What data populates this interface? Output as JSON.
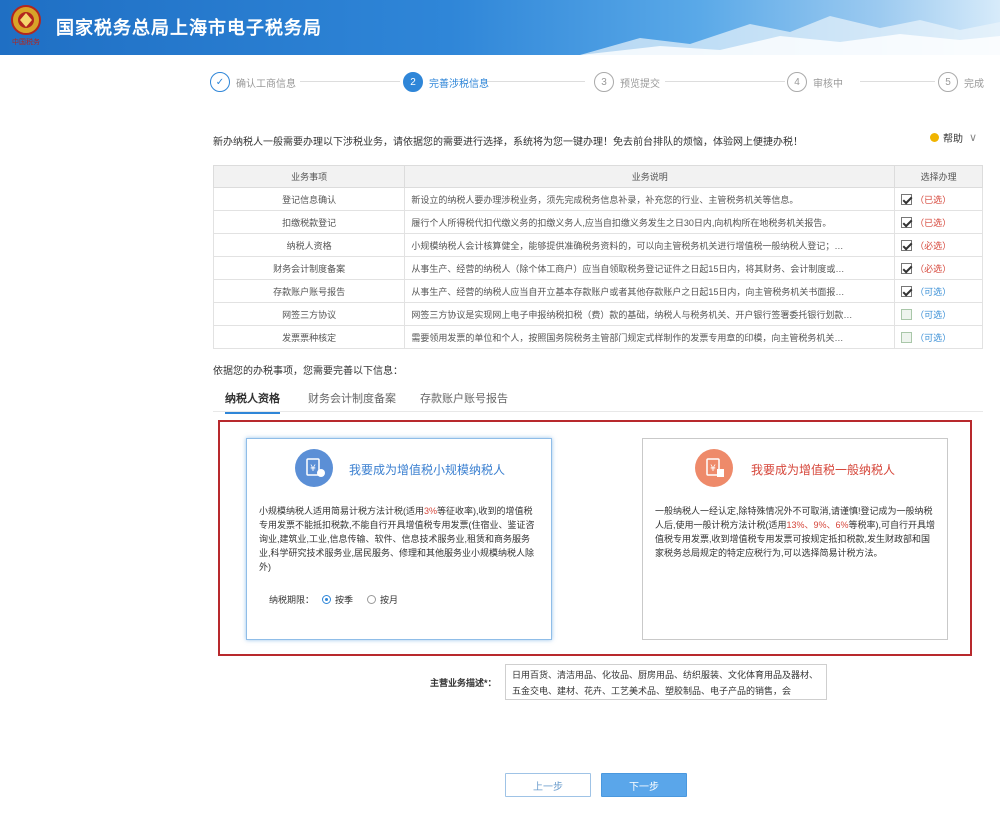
{
  "header": {
    "title": "国家税务总局上海市电子税务局",
    "logo_text": "中国税务"
  },
  "steps": [
    {
      "num": "✓",
      "label": "确认工商信息",
      "state": "done"
    },
    {
      "num": "2",
      "label": "完善涉税信息",
      "state": "active"
    },
    {
      "num": "3",
      "label": "预览提交",
      "state": "todo"
    },
    {
      "num": "4",
      "label": "审核中",
      "state": "todo"
    },
    {
      "num": "5",
      "label": "完成",
      "state": "todo"
    }
  ],
  "intro": "新办纳税人一般需要办理以下涉税业务，请依据您的需要进行选择，系统将为您一键办理！免去前台排队的烦恼，体验网上便捷办税！",
  "help": "帮助",
  "table": {
    "headers": [
      "业务事项",
      "业务说明",
      "选择办理"
    ],
    "rows": [
      {
        "item": "登记信息确认",
        "desc": "新设立的纳税人要办理涉税业务，须先完成税务信息补录，补充您的行业、主管税务机关等信息。",
        "tag": "（已选）",
        "tag_color": "red",
        "checked": true
      },
      {
        "item": "扣缴税款登记",
        "desc": "履行个人所得税代扣代缴义务的扣缴义务人,应当自扣缴义务发生之日30日内,向机构所在地税务机关报告。",
        "tag": "（已选）",
        "tag_color": "red",
        "checked": true
      },
      {
        "item": "纳税人资格",
        "desc": "小规模纳税人会计核算健全，能够提供准确税务资料的，可以向主管税务机关进行增值税一般纳税人登记；…",
        "tag": "（必选）",
        "tag_color": "red",
        "checked": true
      },
      {
        "item": "财务会计制度备案",
        "desc": "从事生产、经营的纳税人（除个体工商户）应当自领取税务登记证件之日起15日内，将其财务、会计制度或…",
        "tag": "（必选）",
        "tag_color": "red",
        "checked": true
      },
      {
        "item": "存款账户账号报告",
        "desc": "从事生产、经营的纳税人应当自开立基本存款账户或者其他存款账户之日起15日内，向主管税务机关书面报…",
        "tag": "（可选）",
        "tag_color": "blue",
        "checked": true
      },
      {
        "item": "网签三方协议",
        "desc": "网签三方协议是实现网上电子申报纳税扣税（费）款的基础，纳税人与税务机关、开户银行签署委托银行划款…",
        "tag": "（可选）",
        "tag_color": "blue",
        "checked": false
      },
      {
        "item": "发票票种核定",
        "desc": "需要领用发票的单位和个人，按照国务院税务主管部门规定式样制作的发票专用章的印模，向主管税务机关…",
        "tag": "（可选）",
        "tag_color": "blue",
        "checked": false
      }
    ]
  },
  "need_text": "依据您的办税事项，您需要完善以下信息：",
  "tabs": [
    "纳税人资格",
    "财务会计制度备案",
    "存款账户账号报告"
  ],
  "card_small": {
    "title": "我要成为增值税小规模纳税人",
    "text_a": "小规模纳税人适用简易计税方法计税(适用",
    "text_hl": "3%",
    "text_b": "等征收率),收到的增值税专用发票不能抵扣税款,不能自行开具增值税专用发票(住宿业、鉴证咨询业,建筑业,工业,信息传输、软件、信息技术服务业,租赁和商务服务业,科学研究技术服务业,居民服务、修理和其他服务业小规模纳税人除外)",
    "period_label": "纳税期限：",
    "period_options": [
      "按季",
      "按月"
    ]
  },
  "card_general": {
    "title": "我要成为增值税一般纳税人",
    "text_a": "一般纳税人一经认定,除特殊情况外不可取消,请谨慎!登记成为一般纳税人后,使用一般计税方法计税(适用",
    "text_hl": "13%、9%、6%",
    "text_b": "等税率),可自行开具增值税专用发票,收到增值税专用发票可按规定抵扣税款,发生财政部和国家税务总局规定的特定应税行为,可以选择简易计税方法。"
  },
  "business": {
    "label": "主营业务描述*：",
    "value": "日用百货、清洁用品、化妆品、厨房用品、纺织服装、文化体育用品及器材、五金交电、建材、花卉、工艺美术品、塑胶制品、电子产品的销售，会"
  },
  "buttons": {
    "prev": "上一步",
    "next": "下一步"
  },
  "colors": {
    "primary": "#2f86d8",
    "required": "#d6463a",
    "highlight_border": "#b8292d"
  }
}
